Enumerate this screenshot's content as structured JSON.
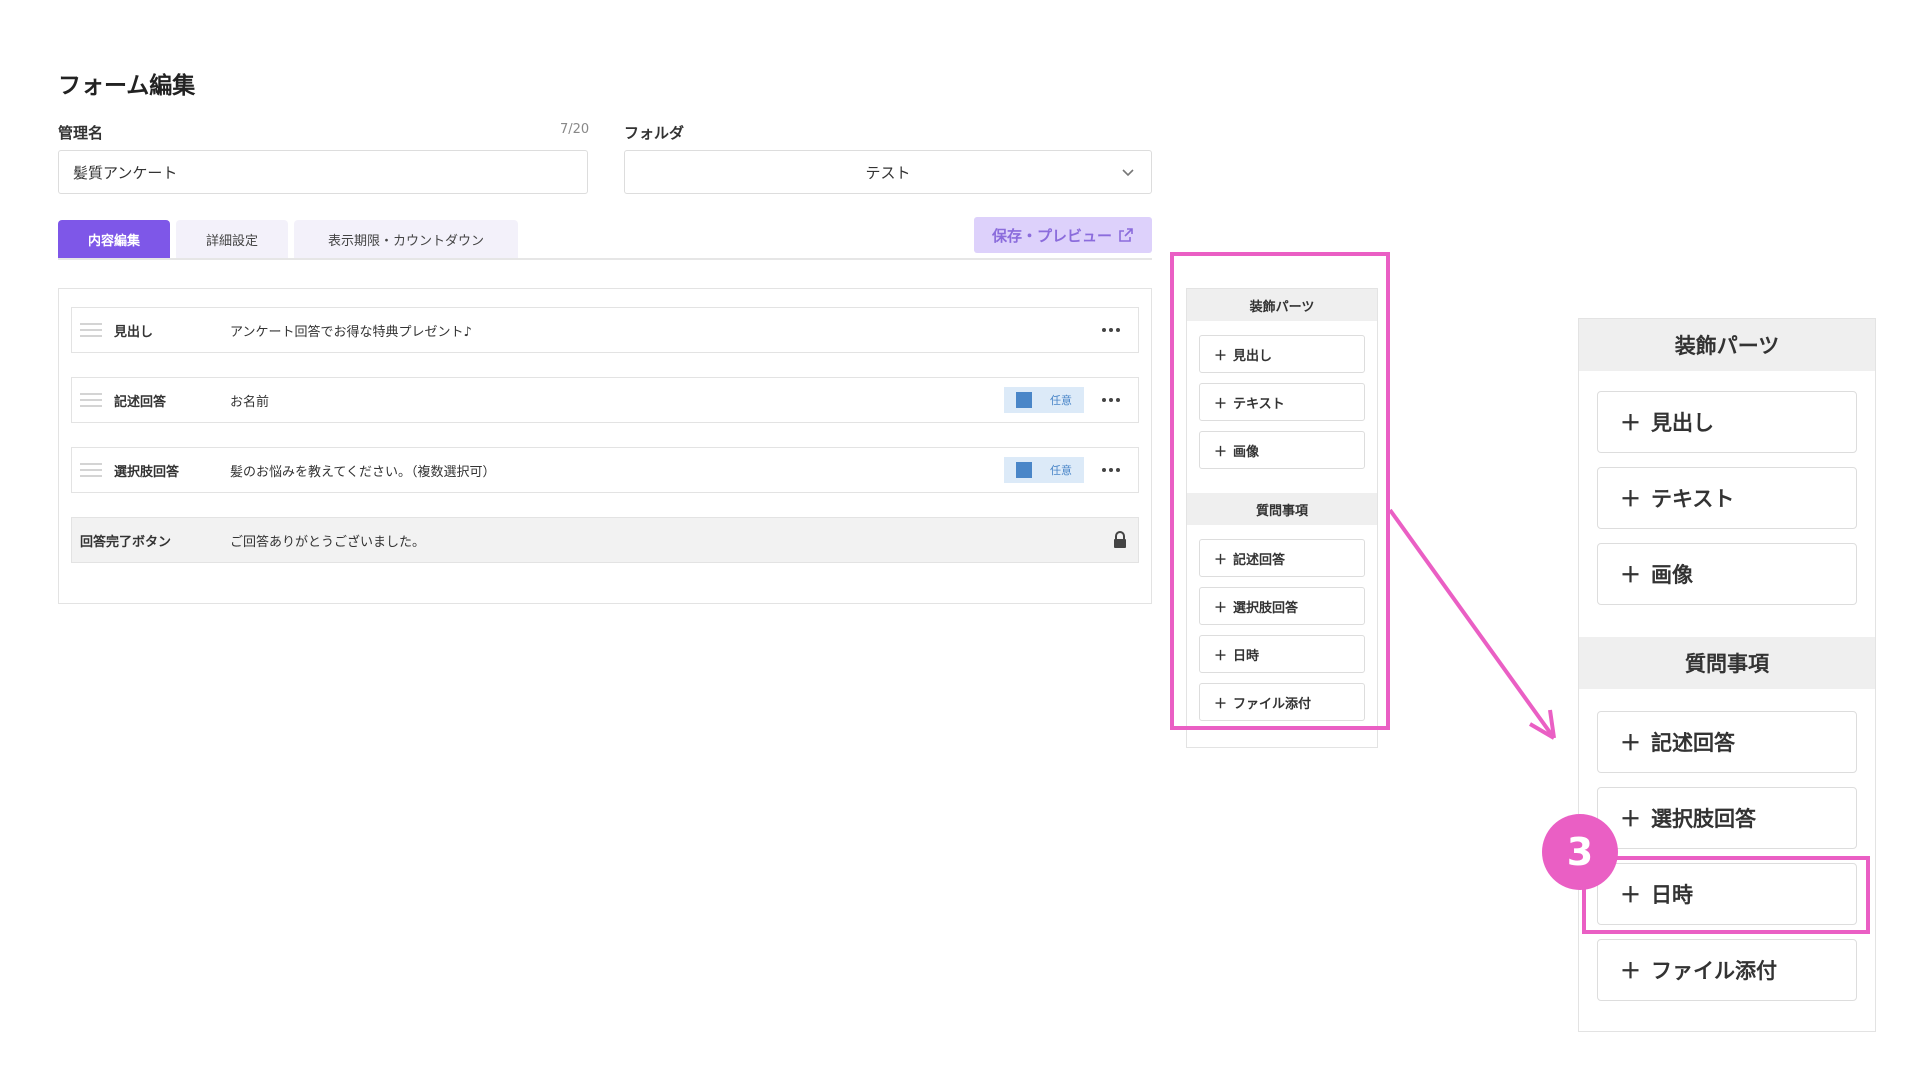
{
  "page_title": "フォーム編集",
  "fields": {
    "name_label": "管理名",
    "name_counter": "7/20",
    "name_value": "髪質アンケート",
    "folder_label": "フォルダ",
    "folder_value": "テスト"
  },
  "tabs": [
    {
      "label": "内容編集",
      "active": true
    },
    {
      "label": "詳細設定",
      "active": false
    },
    {
      "label": "表示期限・カウントダウン",
      "active": false
    }
  ],
  "save_preview_label": "保存・プレビュー",
  "rows": [
    {
      "type": "見出し",
      "content": "アンケート回答でお得な特典プレゼント♪"
    },
    {
      "type": "記述回答",
      "content": "お名前",
      "badge": "任意"
    },
    {
      "type": "選択肢回答",
      "content": "髪のお悩みを教えてください。（複数選択可）",
      "badge": "任意"
    },
    {
      "type": "回答完了ボタン",
      "content": "ご回答ありがとうございました。"
    }
  ],
  "parts_panel": {
    "decoration_title": "装飾パーツ",
    "decoration_items": [
      "見出し",
      "テキスト",
      "画像"
    ],
    "question_title": "質問事項",
    "question_items": [
      "記述回答",
      "選択肢回答",
      "日時",
      "ファイル添付"
    ]
  },
  "step_number": "3",
  "colors": {
    "accent": "#7e57e8",
    "highlight": "#ea5fc4",
    "badge_blue": "#4a86c8"
  }
}
